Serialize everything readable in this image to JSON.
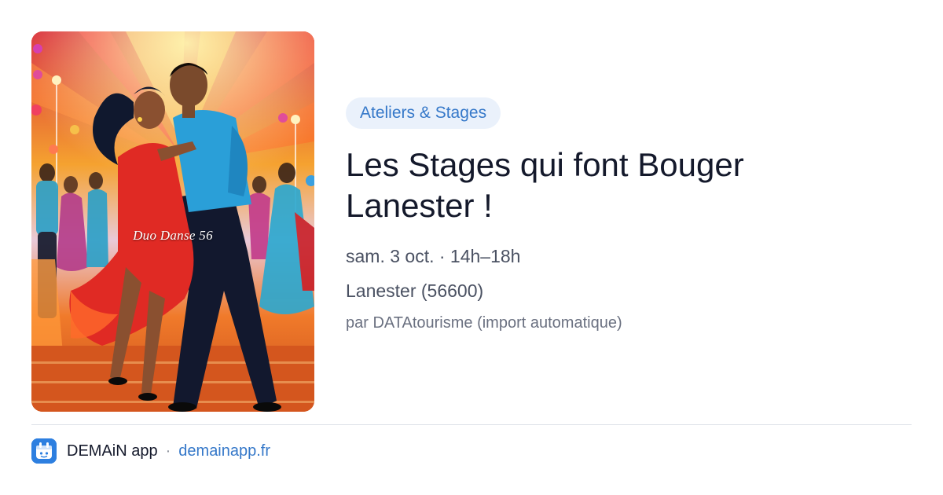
{
  "poster": {
    "caption": "Duo Danse 56",
    "colors": {
      "sky_top": "#d8283a",
      "sky_mid": "#f5a230",
      "floor": "#c94d1c",
      "dress": "#e02a24",
      "shirt": "#2a9fd8",
      "trousers": "#12182e"
    }
  },
  "event": {
    "category": "Ateliers & Stages",
    "title": "Les Stages qui font Bouger Lanester !",
    "date": "sam. 3 oct. · 14h–18h",
    "place": "Lanester (56600)",
    "source": "par DATAtourisme (import automatique)"
  },
  "footer": {
    "app_name": "DEMAiN app",
    "separator": "·",
    "site": "demainapp.fr",
    "icon": "app-logo-icon",
    "accent": "#2d7fe0"
  }
}
